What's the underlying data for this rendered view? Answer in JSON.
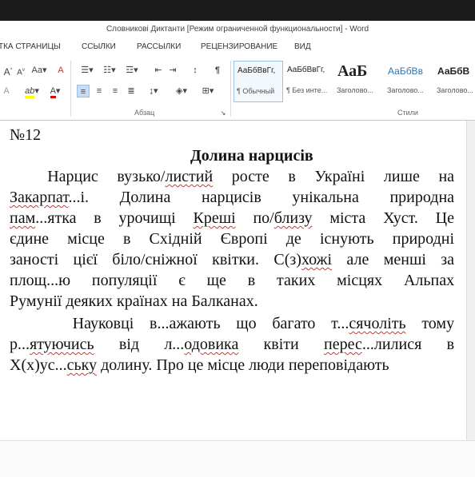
{
  "window": {
    "title": "Словникові Диктанти [Режим ограниченной функциональности] - Word"
  },
  "ribbon_tabs": [
    "ТКА СТРАНИЦЫ",
    "ССЫЛКИ",
    "РАССЫЛКИ",
    "РЕЦЕНЗИРОВАНИЕ",
    "ВИД"
  ],
  "ribbon": {
    "font_grow": "A",
    "font_shrink": "A",
    "change_case": "Aa",
    "clear_format": "A",
    "text_effects": "A",
    "highlight": "ab",
    "font_color": "A",
    "show_marks": "¶",
    "group_paragraph": "Абзац",
    "group_styles": "Стили",
    "styles": [
      {
        "preview": "АаБбВвГг,",
        "name": "¶ Обычный",
        "selected": true
      },
      {
        "preview": "АаБбВвГг,",
        "name": "¶ Без инте..."
      },
      {
        "preview": "АаБ",
        "name": "Заголово..."
      },
      {
        "preview": "АаБбВв",
        "name": "Заголово..."
      },
      {
        "preview": "АаБбВ",
        "name": "Заголово..."
      }
    ],
    "accent_color": "#2b579a",
    "highlight_color": "#ffff00",
    "font_color_bar": "#e00000"
  },
  "document": {
    "number": "№12",
    "title": "Долина нарцисів",
    "p1": {
      "l1": [
        "Нарцис",
        "вузько/",
        "листий",
        "росте",
        "в",
        "Україні",
        "лише",
        "на"
      ],
      "l2": [
        "Закарпат",
        "...і.",
        "Долина",
        "нарцисів",
        "унікальна",
        "природна"
      ],
      "l3": [
        "пам",
        "...ятка",
        "в",
        "урочищі",
        "Креші",
        "по/",
        "близу",
        "міста",
        "Хуст.",
        "Це"
      ],
      "l4": [
        "єдине",
        "місце",
        "в",
        "Східній",
        "Європі",
        "де",
        "існують",
        "природні"
      ],
      "l5": [
        "заності",
        "цієї",
        "біло/сніжної",
        "квітки.",
        "С(з)",
        "хожі",
        "але",
        "менші",
        "за"
      ],
      "l6": [
        "площ...ю",
        "популяції",
        "є",
        "ще",
        "в",
        "таких",
        "місцях",
        "Альпах"
      ],
      "l7": "Румунії  деяких країнах на Балканах."
    },
    "p2": {
      "l1": [
        "Науковці",
        "в...ажають",
        "що",
        "багато",
        "т...",
        "сячоліть",
        "тому"
      ],
      "l2": [
        "р...",
        "ятуючись",
        "від",
        "л...",
        "одовика",
        "квіти",
        "перес",
        "...лилися",
        "в"
      ],
      "l3": [
        "Х(х)ус...",
        "ську",
        "долину.",
        "Про це місце люди переповідають"
      ]
    }
  }
}
